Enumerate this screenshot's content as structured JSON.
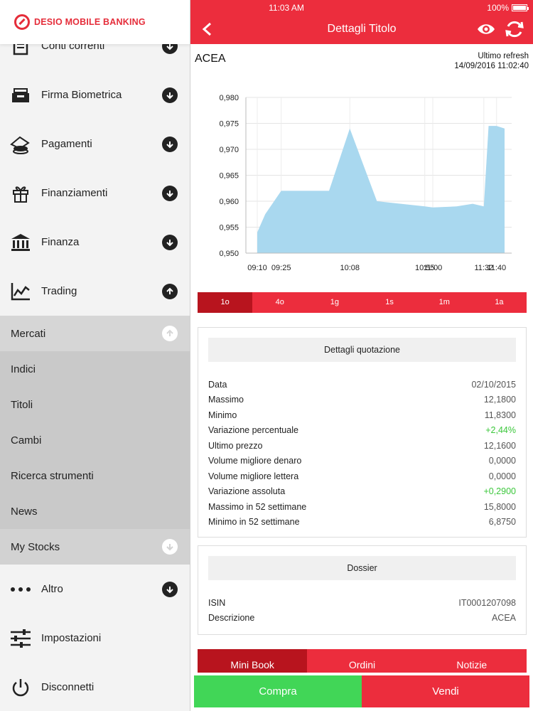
{
  "app": {
    "logo_text": "DESIO MOBILE BANKING"
  },
  "status_bar": {
    "time": "11:03 AM",
    "battery": "100%"
  },
  "sidebar": {
    "items": [
      {
        "label": "Conti correnti",
        "icon": "ledger-icon",
        "arrow": "down"
      },
      {
        "label": "Firma Biometrica",
        "icon": "tray-icon",
        "arrow": "down"
      },
      {
        "label": "Pagamenti",
        "icon": "coins-icon",
        "arrow": "down"
      },
      {
        "label": "Finanziamenti",
        "icon": "gift-icon",
        "arrow": "down"
      },
      {
        "label": "Finanza",
        "icon": "bank-icon",
        "arrow": "down"
      },
      {
        "label": "Trading",
        "icon": "chart-icon",
        "arrow": "up"
      }
    ],
    "trading_sub": {
      "mercati": "Mercati",
      "items": [
        "Indici",
        "Titoli",
        "Cambi",
        "Ricerca strumenti",
        "News"
      ],
      "my_stocks": "My Stocks"
    },
    "bottom_items": [
      {
        "label": "Altro",
        "icon": "dots-icon"
      },
      {
        "label": "Impostazioni",
        "icon": "sliders-icon"
      },
      {
        "label": "Disconnetti",
        "icon": "power-icon"
      }
    ]
  },
  "header": {
    "title": "Dettagli Titolo"
  },
  "security": {
    "name": "ACEA",
    "refresh_label": "Ultimo refresh",
    "refresh_time": "14/09/2016 11:02:40"
  },
  "chart_data": {
    "type": "area",
    "x": [
      "09:10",
      "09:15",
      "09:25",
      "09:55",
      "10:08",
      "10:25",
      "10:55",
      "11:00",
      "11:15",
      "11:25",
      "11:32",
      "11:35",
      "11:40",
      "11:45"
    ],
    "values": [
      0.954,
      0.9575,
      0.962,
      0.962,
      0.974,
      0.96,
      0.959,
      0.9588,
      0.959,
      0.9595,
      0.959,
      0.9745,
      0.9745,
      0.974
    ],
    "xticks": [
      "09:10",
      "09:25",
      "10:08",
      "10:55",
      "11:00",
      "11:32",
      "11:40"
    ],
    "yticks": [
      "0,950",
      "0,955",
      "0,960",
      "0,965",
      "0,970",
      "0,975",
      "0,980"
    ],
    "ylim": [
      0.95,
      0.98
    ],
    "fill_color": "#a9d8ef",
    "grid": true
  },
  "periods": [
    "1o",
    "4o",
    "1g",
    "1s",
    "1m",
    "1a"
  ],
  "quotation": {
    "title": "Dettagli quotazione",
    "rows": [
      {
        "k": "Data",
        "v": "02/10/2015",
        "pos": false
      },
      {
        "k": "Massimo",
        "v": "12,1800",
        "pos": false
      },
      {
        "k": "Minimo",
        "v": "11,8300",
        "pos": false
      },
      {
        "k": "Variazione percentuale",
        "v": "+2,44%",
        "pos": true
      },
      {
        "k": "Ultimo prezzo",
        "v": "12,1600",
        "pos": false
      },
      {
        "k": "Volume migliore denaro",
        "v": "0,0000",
        "pos": false
      },
      {
        "k": "Volume migliore lettera",
        "v": "0,0000",
        "pos": false
      },
      {
        "k": "Variazione assoluta",
        "v": "+0,2900",
        "pos": true
      },
      {
        "k": "Massimo in 52 settimane",
        "v": "15,8000",
        "pos": false
      },
      {
        "k": "Minimo in 52 settimane",
        "v": "6,8750",
        "pos": false
      }
    ]
  },
  "dossier": {
    "title": "Dossier",
    "rows": [
      {
        "k": "ISIN",
        "v": "IT0001207098"
      },
      {
        "k": "Descrizione",
        "v": "ACEA"
      }
    ]
  },
  "bottom_tabs": [
    "Mini Book",
    "Ordini",
    "Notizie"
  ],
  "actions": {
    "buy": "Compra",
    "sell": "Vendi"
  },
  "colors": {
    "accent": "#ec2d3d",
    "accent_dark": "#b8141e",
    "buy": "#41d657",
    "positive": "#3bc73b"
  }
}
